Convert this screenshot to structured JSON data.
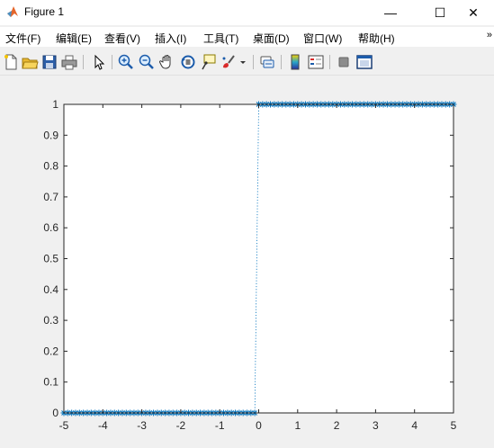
{
  "window": {
    "title": "Figure 1",
    "minimize_glyph": "—",
    "maximize_glyph": "☐",
    "close_glyph": "✕"
  },
  "menu": [
    {
      "label": "文件(F)"
    },
    {
      "label": "编辑(E)"
    },
    {
      "label": "查看(V)"
    },
    {
      "label": "插入(I)"
    },
    {
      "label": "工具(T)"
    },
    {
      "label": "桌面(D)"
    },
    {
      "label": "窗口(W)"
    },
    {
      "label": "帮助(H)"
    }
  ],
  "menu_overflow": "»",
  "toolbar_icons": [
    "new-figure-icon",
    "open-file-icon",
    "save-icon",
    "print-icon",
    "select-arrow-icon",
    "zoom-in-icon",
    "zoom-out-icon",
    "pan-hand-icon",
    "rotate-3d-icon",
    "data-cursor-icon",
    "brush-icon",
    "link-plot-icon",
    "colorbar-icon",
    "legend-icon",
    "hide-plot-tools-icon",
    "show-plot-tools-icon"
  ],
  "chart_data": {
    "type": "scatter",
    "title": "",
    "xlabel": "",
    "ylabel": "",
    "xlim": [
      -5,
      5
    ],
    "ylim": [
      0,
      1
    ],
    "x_ticks": [
      "-5",
      "-4",
      "-3",
      "-2",
      "-1",
      "0",
      "1",
      "2",
      "3",
      "4",
      "5"
    ],
    "y_ticks": [
      "0",
      "0.1",
      "0.2",
      "0.3",
      "0.4",
      "0.5",
      "0.6",
      "0.7",
      "0.8",
      "0.9",
      "1"
    ],
    "grid": false,
    "series": [
      {
        "marker": "*",
        "line_style": "dotted",
        "color": "#0072bd",
        "x_start": -5,
        "x_end": 5,
        "x_step": 0.1,
        "step_at": 0,
        "value_below": 0,
        "value_at_and_above": 1
      }
    ]
  }
}
